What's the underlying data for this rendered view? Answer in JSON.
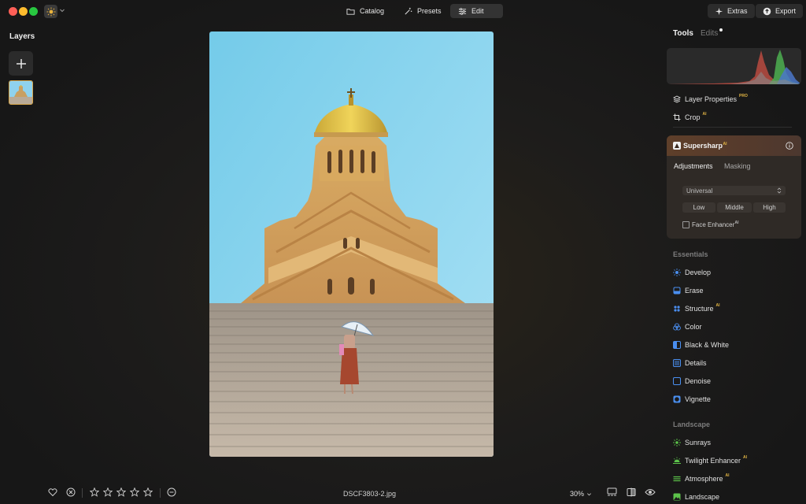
{
  "toolbar": {
    "catalog_label": "Catalog",
    "presets_label": "Presets",
    "edit_label": "Edit",
    "extras_label": "Extras",
    "export_label": "Export"
  },
  "left_panel": {
    "title": "Layers"
  },
  "image": {
    "filename": "DSCF3803-2.jpg",
    "zoom": "30%",
    "rating_stars": 0
  },
  "right_panel": {
    "tab_tools": "Tools",
    "tab_edits": "Edits",
    "layer_properties": {
      "label": "Layer Properties",
      "badge": "PRO"
    },
    "crop": {
      "label": "Crop",
      "badge": "AI"
    },
    "supersharp": {
      "title": "Supersharp",
      "badge": "AI",
      "tab_adjustments": "Adjustments",
      "tab_masking": "Masking",
      "mode_value": "Universal",
      "levels": [
        "Low",
        "Middle",
        "High"
      ],
      "face_enhancer": {
        "label": "Face Enhancer",
        "badge": "AI",
        "checked": false
      }
    },
    "essentials_title": "Essentials",
    "essentials": [
      {
        "label": "Develop",
        "badge": ""
      },
      {
        "label": "Erase",
        "badge": ""
      },
      {
        "label": "Structure",
        "badge": "AI"
      },
      {
        "label": "Color",
        "badge": ""
      },
      {
        "label": "Black & White",
        "badge": ""
      },
      {
        "label": "Details",
        "badge": ""
      },
      {
        "label": "Denoise",
        "badge": ""
      },
      {
        "label": "Vignette",
        "badge": ""
      }
    ],
    "landscape_title": "Landscape",
    "landscape": [
      {
        "label": "Sunrays",
        "badge": ""
      },
      {
        "label": "Twilight Enhancer",
        "badge": "AI"
      },
      {
        "label": "Atmosphere",
        "badge": "AI"
      },
      {
        "label": "Landscape",
        "badge": ""
      }
    ]
  },
  "colors": {
    "accent_gold": "#d7a64a",
    "essentials_icon": "#4a8ff0",
    "landscape_icon": "#5cc24a"
  }
}
